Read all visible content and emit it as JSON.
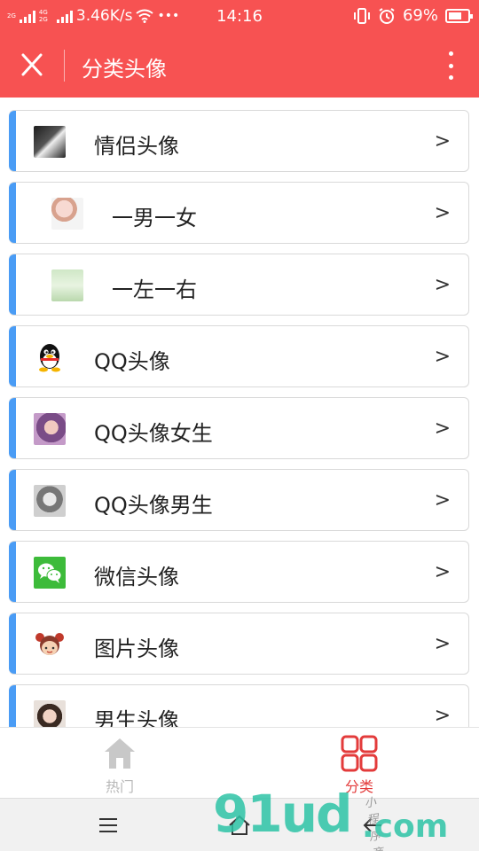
{
  "status_bar": {
    "network_badge_1": "2G",
    "network_badge_2": "4G 2G",
    "speed": "3.46K/s",
    "more": "•••",
    "time": "14:16",
    "battery_percent": "69%",
    "battery_level": 0.69
  },
  "header": {
    "title": "分类头像",
    "close_icon": "close-icon",
    "more_icon": "more-vertical-icon"
  },
  "list": {
    "items": [
      {
        "label": "情侣头像",
        "thumb": "couple-avatar",
        "indented": false,
        "chevron": ">"
      },
      {
        "label": "一男一女",
        "thumb": "couple-pink-avatar",
        "indented": true,
        "chevron": ">"
      },
      {
        "label": "一左一右",
        "thumb": "couple-green-avatar",
        "indented": true,
        "chevron": ">"
      },
      {
        "label": "QQ头像",
        "thumb": "qq-penguin-icon",
        "indented": false,
        "chevron": ">"
      },
      {
        "label": "QQ头像女生",
        "thumb": "girl-avatar",
        "indented": false,
        "chevron": ">"
      },
      {
        "label": "QQ头像男生",
        "thumb": "boy-bw-avatar",
        "indented": false,
        "chevron": ">"
      },
      {
        "label": "微信头像",
        "thumb": "wechat-icon",
        "indented": false,
        "chevron": ">"
      },
      {
        "label": "图片头像",
        "thumb": "cartoon-girl-icon",
        "indented": false,
        "chevron": ">"
      },
      {
        "label": "男生头像",
        "thumb": "boy-avatar",
        "indented": false,
        "chevron": ">"
      }
    ],
    "accent_color": "#4a9cf5"
  },
  "tabbar": {
    "tabs": [
      {
        "label": "热门",
        "icon": "home-icon",
        "active": false
      },
      {
        "label": "分类",
        "icon": "grid-icon",
        "active": true
      }
    ],
    "active_color": "#e33b3b"
  },
  "watermark": {
    "main": "91ud",
    "suffix": ".com",
    "tagline": "小程序商店"
  },
  "theme": {
    "header_color": "#f75252"
  }
}
